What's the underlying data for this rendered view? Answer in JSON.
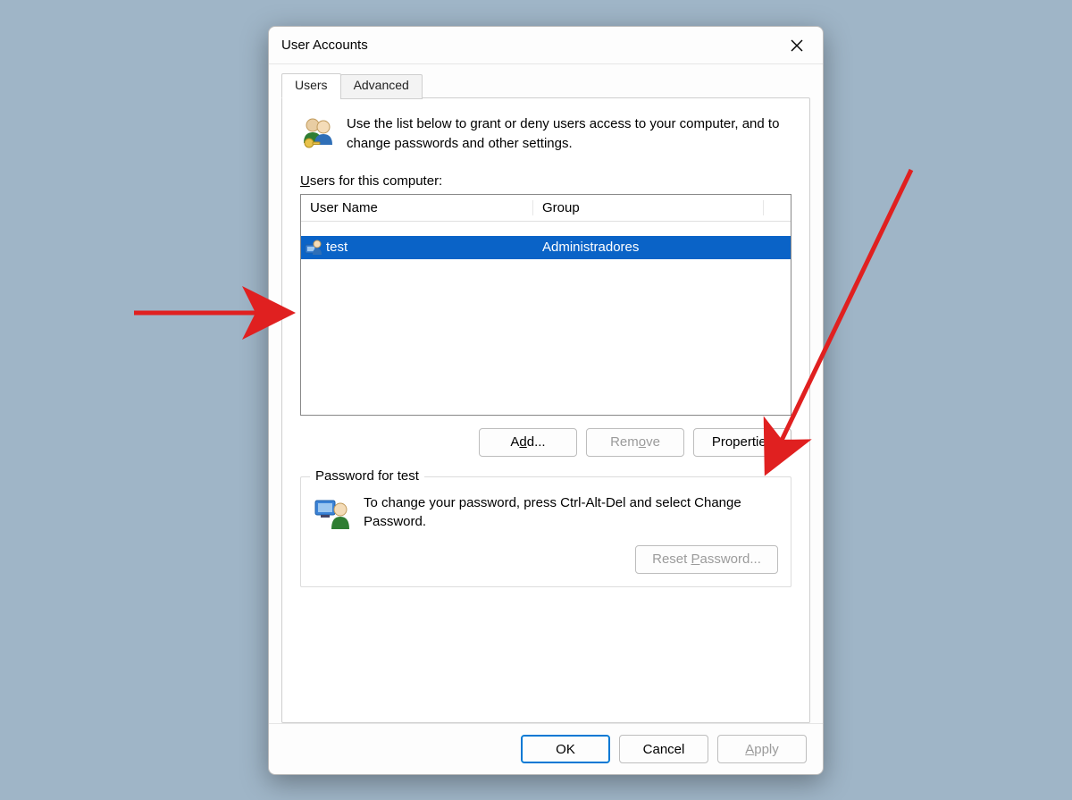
{
  "window": {
    "title": "User Accounts"
  },
  "tabs": {
    "users": "Users",
    "advanced": "Advanced"
  },
  "intro": "Use the list below to grant or deny users access to your computer, and to change passwords and other settings.",
  "users_label_pre": "U",
  "users_label_post": "sers for this computer:",
  "columns": {
    "name": "User Name",
    "group": "Group"
  },
  "rows": [
    {
      "name": "test",
      "group": "Administradores",
      "selected": true
    }
  ],
  "buttons": {
    "add": "Add...",
    "add_hotkey": "d",
    "remove": "Remove",
    "remove_hotkey": "o",
    "properties": "Properties",
    "ok": "OK",
    "cancel": "Cancel",
    "apply": "Apply",
    "apply_hotkey": "A",
    "reset_pw": "Reset Password...",
    "reset_hotkey": "P"
  },
  "password_group": {
    "legend": "Password for test",
    "text": "To change your password, press Ctrl-Alt-Del and select Change Password."
  }
}
